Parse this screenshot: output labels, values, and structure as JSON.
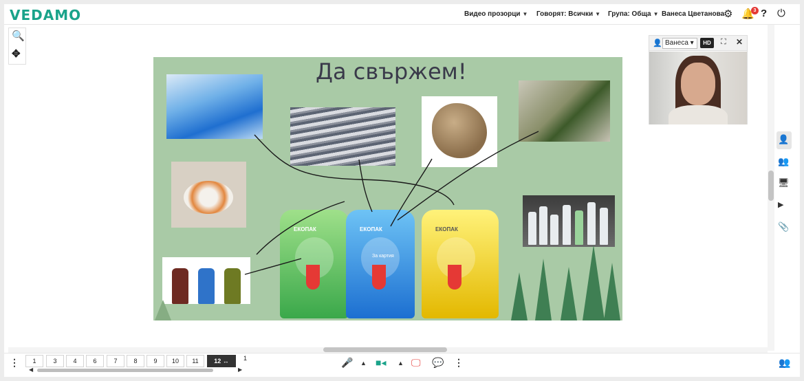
{
  "app": {
    "logo": "VEDAMO"
  },
  "topbar": {
    "video_windows": "Видео прозорци",
    "speakers": "Говорят: Всички",
    "group": "Група: Обща",
    "user_name": "Ванеса Цветанова",
    "notification_count": "3",
    "help_label": "?"
  },
  "slide": {
    "title": "Да свържем!",
    "bin_label": "ЕКОПАК",
    "bin_text": "За картия"
  },
  "video": {
    "participant": "Ванеса",
    "quality": "HD"
  },
  "pages": {
    "items": [
      "1",
      "3",
      "4",
      "6",
      "7",
      "8",
      "9",
      "10",
      "11"
    ],
    "current": "12",
    "extra": "1"
  },
  "colors": {
    "brand": "#1aa38a",
    "slide_bg": "#a9caa6",
    "mic": "#1aa38a",
    "camera": "#1aa38a",
    "screen_share": "#e53935"
  },
  "icons": {
    "settings": "gear-icon",
    "notifications": "bell-icon",
    "help": "help-icon",
    "power": "power-icon",
    "zoom": "zoom-in-icon",
    "fit": "fit-screen-icon"
  }
}
